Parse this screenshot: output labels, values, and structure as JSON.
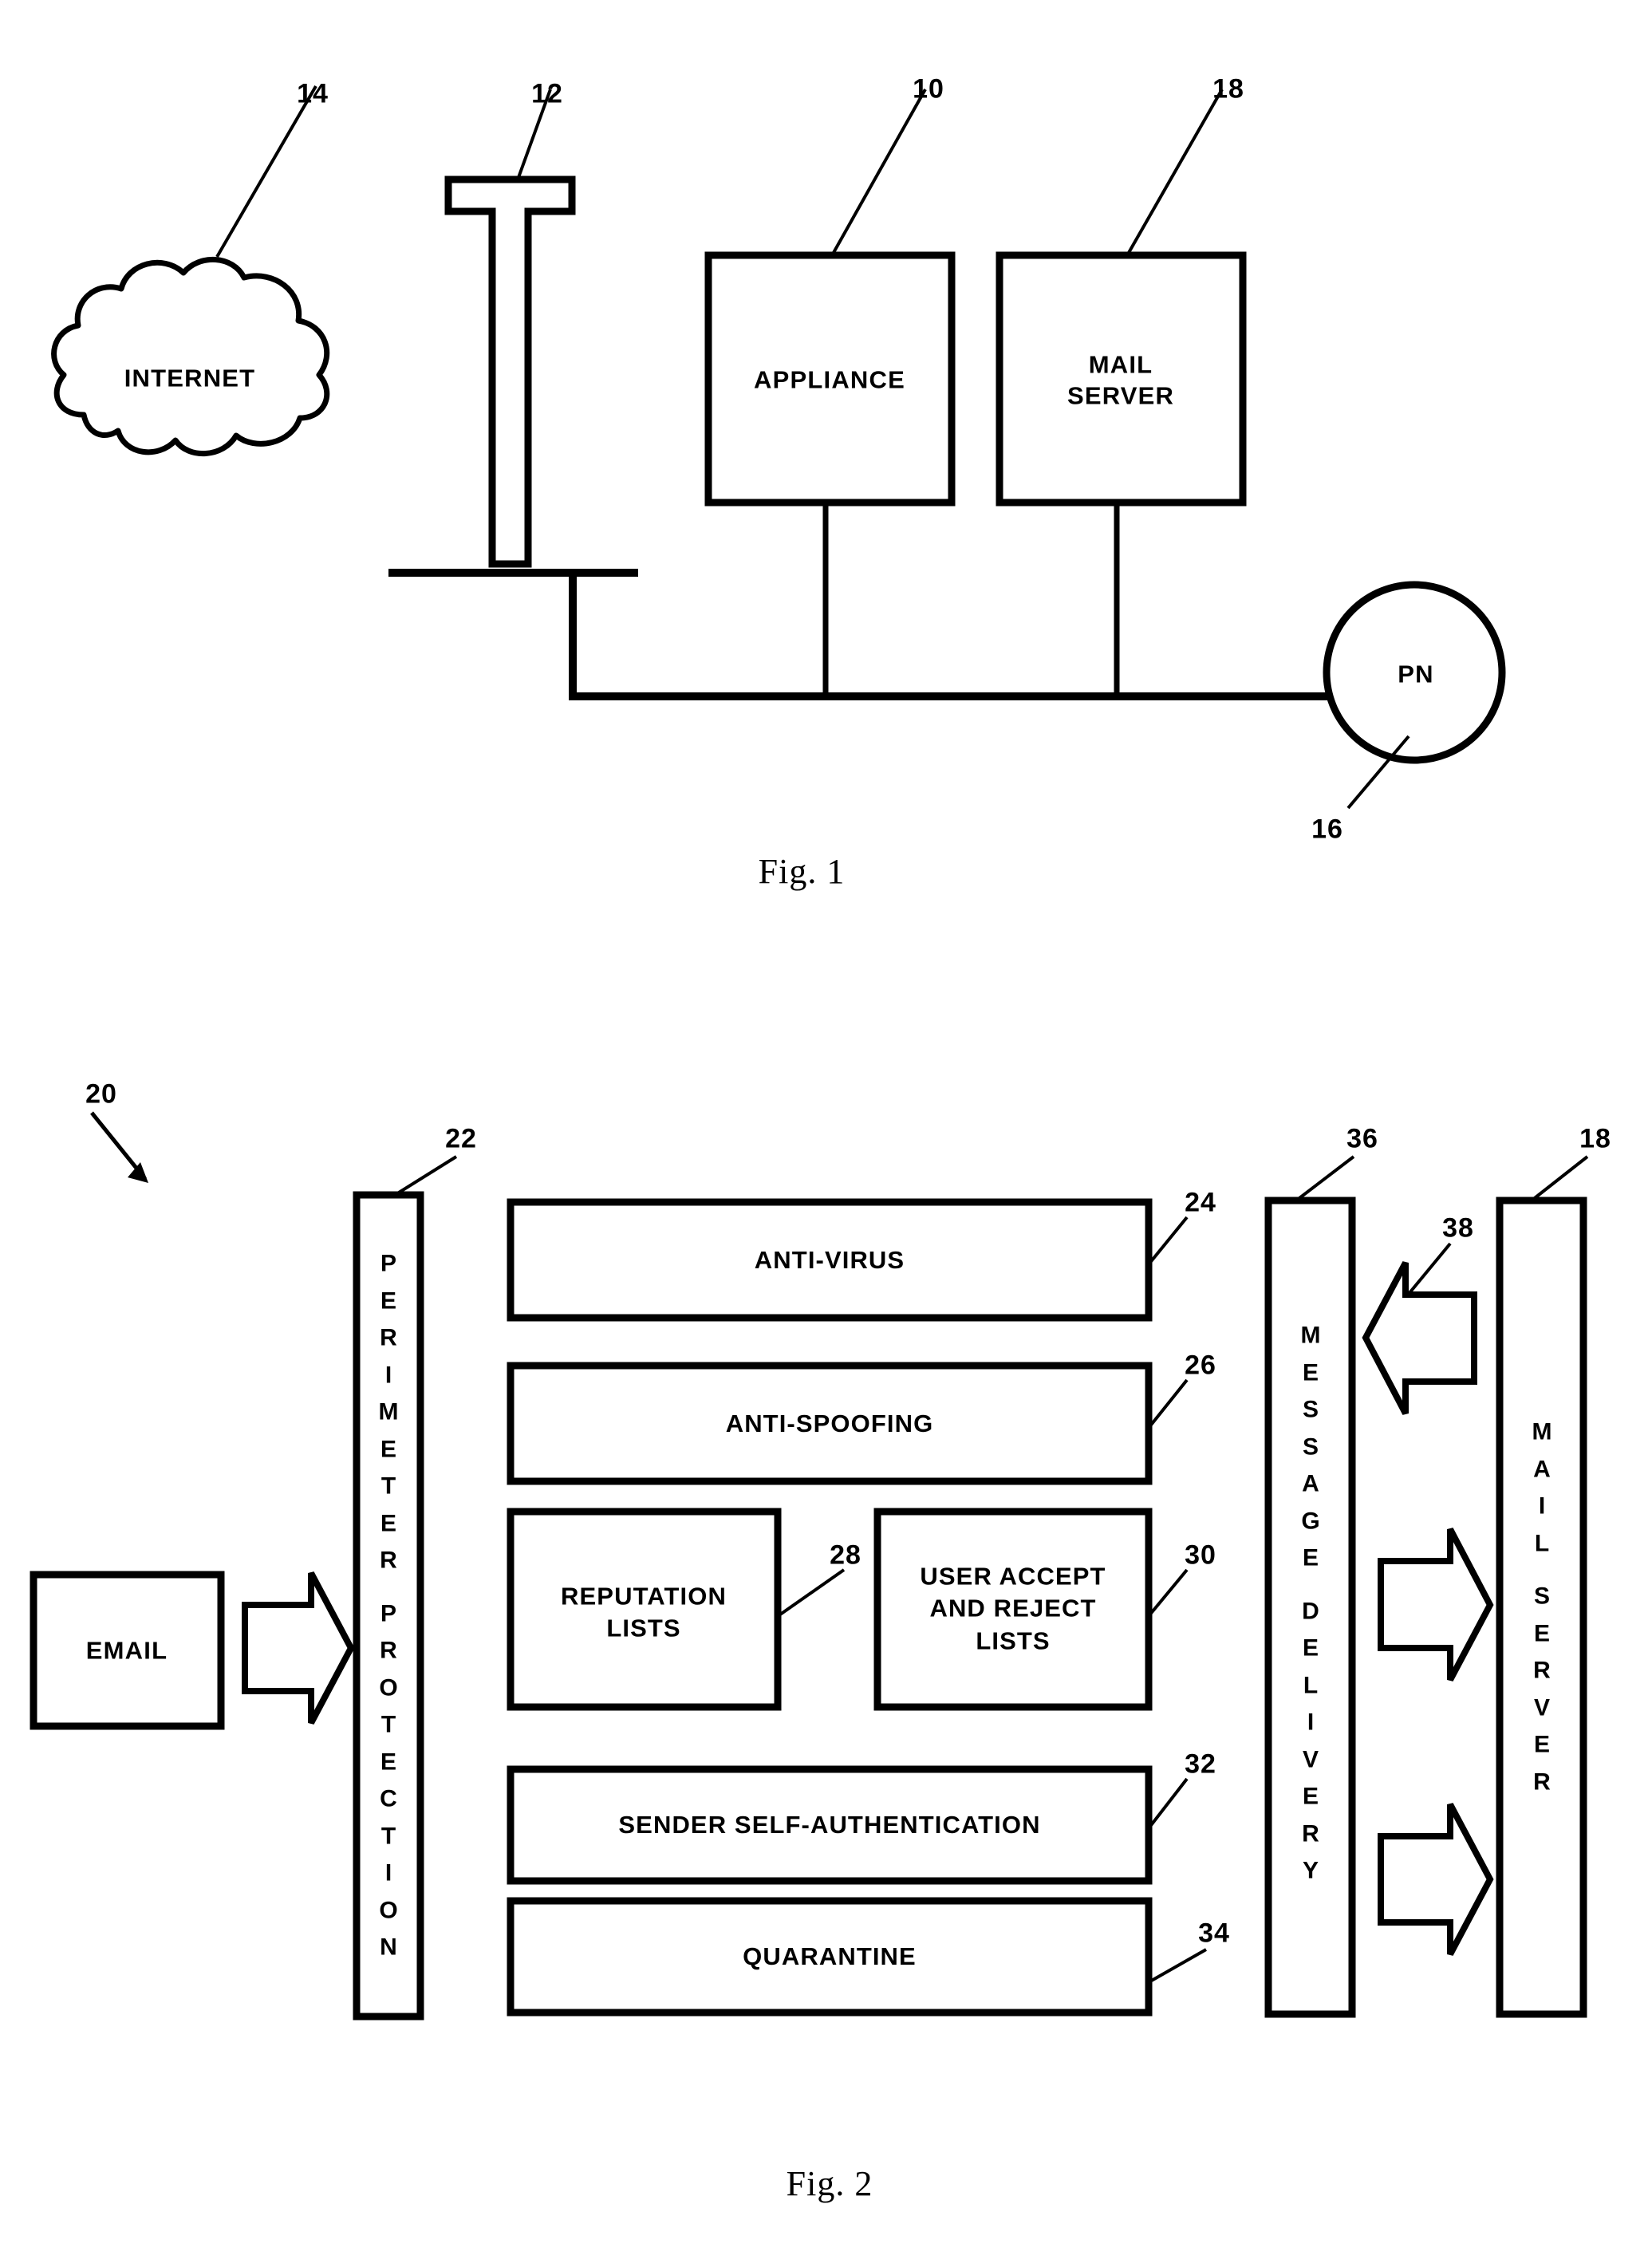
{
  "sheet": {
    "background": "#ffffff",
    "ink": "#000000"
  },
  "figures": [
    {
      "id": "fig1",
      "caption": "Fig. 1",
      "nodes": {
        "internet": {
          "label": "INTERNET",
          "ref": "14"
        },
        "firewall": {
          "label": "",
          "ref": "12"
        },
        "appliance": {
          "label": "APPLIANCE",
          "ref": "10"
        },
        "mail_server": {
          "label": "MAIL\nSERVER",
          "ref": "18"
        },
        "private_network": {
          "label": "PN",
          "ref": "16"
        }
      }
    },
    {
      "id": "fig2",
      "caption": "Fig. 2",
      "system_ref": "20",
      "source": {
        "label": "EMAIL"
      },
      "perimeter": {
        "label": "PERIMETER PROTECTION",
        "letters": [
          "P",
          "E",
          "R",
          "I",
          "M",
          "E",
          "T",
          "E",
          "R",
          "",
          "P",
          "R",
          "O",
          "T",
          "E",
          "C",
          "T",
          "I",
          "O",
          "N"
        ],
        "ref": "22"
      },
      "modules": [
        {
          "label": "ANTI-VIRUS",
          "ref": "24"
        },
        {
          "label": "ANTI-SPOOFING",
          "ref": "26"
        },
        {
          "label": "REPUTATION\nLISTS",
          "ref": "28"
        },
        {
          "label": "USER ACCEPT\nAND REJECT\nLISTS",
          "ref": "30"
        },
        {
          "label": "SENDER SELF-AUTHENTICATION",
          "ref": "32"
        },
        {
          "label": "QUARANTINE",
          "ref": "34"
        }
      ],
      "delivery": {
        "label": "MESSAGE DELIVERY",
        "letters": [
          "M",
          "E",
          "S",
          "S",
          "A",
          "G",
          "E",
          "",
          "D",
          "E",
          "L",
          "I",
          "V",
          "E",
          "R",
          "Y"
        ],
        "ref": "36"
      },
      "mail_server": {
        "label": "MAIL SERVER",
        "letters": [
          "M",
          "A",
          "I",
          "L",
          "",
          "S",
          "E",
          "R",
          "V",
          "E",
          "R"
        ],
        "ref": "18"
      },
      "feedback_arrow": {
        "ref": "38"
      }
    }
  ]
}
